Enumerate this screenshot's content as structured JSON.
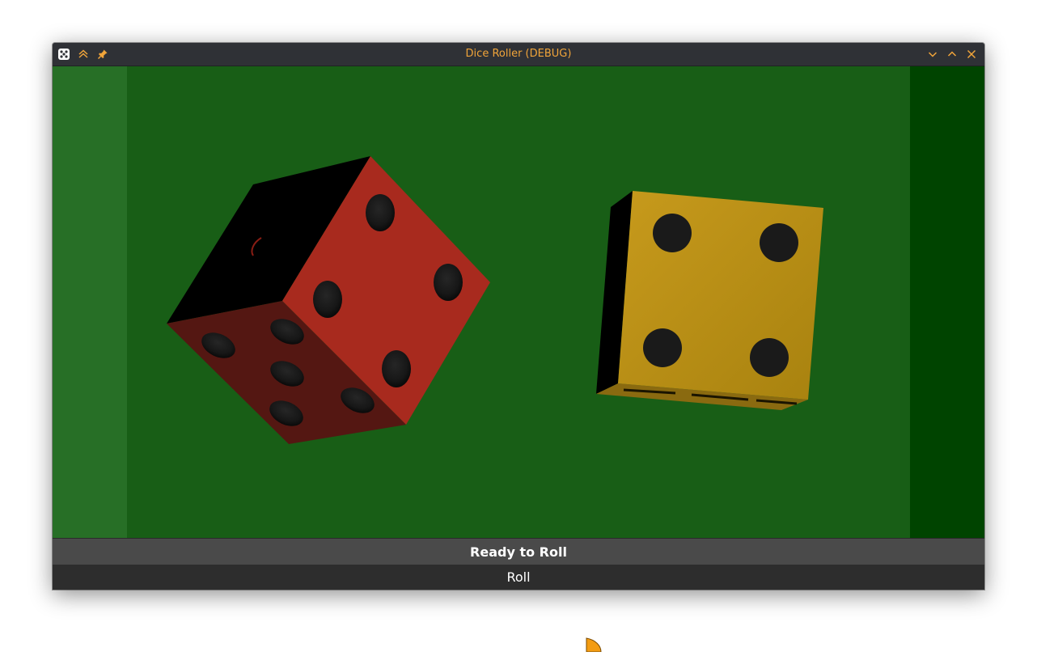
{
  "window": {
    "title": "Dice Roller (DEBUG)",
    "accent_color": "#f0a43a",
    "titlebar_icons": [
      "dice-app-icon",
      "keep-above-icon",
      "pin-icon"
    ],
    "window_controls": [
      "minimize-icon",
      "maximize-icon",
      "close-icon"
    ]
  },
  "scene": {
    "table_color": "#185e16",
    "dice": [
      {
        "name": "red-die",
        "color": "#a82a1e",
        "visible_faces": [
          4,
          5,
          1
        ]
      },
      {
        "name": "yellow-die",
        "color": "#b38a16",
        "visible_faces": [
          4
        ]
      }
    ]
  },
  "status": {
    "text": "Ready to Roll"
  },
  "controls": {
    "roll_label": "Roll"
  }
}
